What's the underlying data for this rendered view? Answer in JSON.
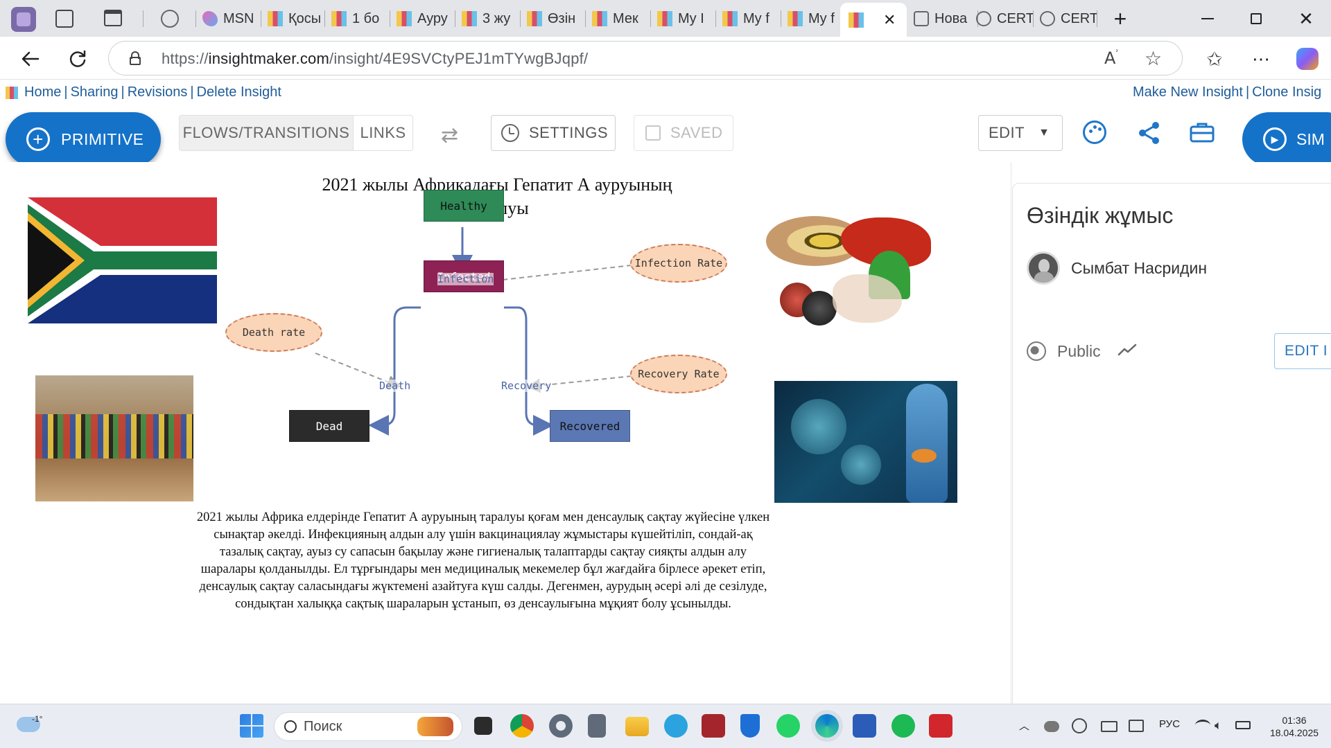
{
  "browser": {
    "tabs": [
      {
        "label": "MSN"
      },
      {
        "label": "Қосы"
      },
      {
        "label": "1 бо"
      },
      {
        "label": "Ауру"
      },
      {
        "label": "3 жу"
      },
      {
        "label": "Өзін"
      },
      {
        "label": "Мек"
      },
      {
        "label": "My I"
      },
      {
        "label": "My f"
      },
      {
        "label": "My f"
      },
      {
        "label": ""
      },
      {
        "label": "Нова"
      },
      {
        "label": "CERT"
      },
      {
        "label": "CERT"
      }
    ],
    "url_prefix": "https://",
    "url_host": "insightmaker.com",
    "url_path": "/insight/4E9SVCtyPEJ1mTYwgBJqpf/"
  },
  "insight_nav": {
    "home": "Home",
    "sharing": "Sharing",
    "revisions": "Revisions",
    "delete": "Delete Insight",
    "make_new": "Make New Insight",
    "clone": "Clone Insig",
    "sep": "|"
  },
  "toolbar": {
    "primitive": "PRIMITIVE",
    "flows": "FLOWS/TRANSITIONS",
    "links": "LINKS",
    "settings": "SETTINGS",
    "saved": "SAVED",
    "edit": "EDIT",
    "simulate": "SIM"
  },
  "diagram": {
    "title": "2021 жылы Африкадағы Гепатит А ауруының таралуы",
    "stocks": {
      "healthy": "Healthy",
      "infected": "Infected",
      "dead": "Dead",
      "recovered": "Recovered"
    },
    "variables": {
      "infection_rate": "Infection Rate",
      "death_rate": "Death rate",
      "recovery_rate": "Recovery Rate"
    },
    "flows": {
      "infection": "Infection",
      "death": "Death",
      "recovery": "Recovery"
    },
    "colors": {
      "healthy": "#2e8b57",
      "infected": "#8e2254",
      "dead": "#2b2b2b",
      "recovered": "#5b78b4",
      "flow": "#5a75b3",
      "variable_fill": "#fbd5b7"
    },
    "description": "2021 жылы Африка елдерінде Гепатит А ауруының таралуы қоғам мен денсаулық сақтау жүйесіне үлкен сынақтар әкелді. Инфекцияның алдын алу үшін вакцинациялау жұмыстары күшейтіліп, сондай-ақ тазалық сақтау, ауыз су сапасын бақылау және гигиеналық талаптарды сақтау сияқты алдын алу шаралары қолданылды. Ел тұрғындары мен медициналық мекемелер бұл жағдайға бірлесе әрекет етіп, денсаулық сақтау саласындағы жүктемені азайтуға күш салды. Дегенмен, аурудың әсері әлі де сезілуде, сондықтан халыққа сақтық шараларын ұстанып, өз денсаулығына мұқият болу ұсынылды."
  },
  "side_panel": {
    "title": "Өзіндік жұмыс",
    "author": "Сымбат Насридин",
    "visibility": "Public",
    "edit": "EDIT I"
  },
  "taskbar": {
    "weather": "-1°",
    "search_placeholder": "Поиск",
    "lang": "РУС",
    "time": "01:36",
    "date": "18.04.2025"
  }
}
